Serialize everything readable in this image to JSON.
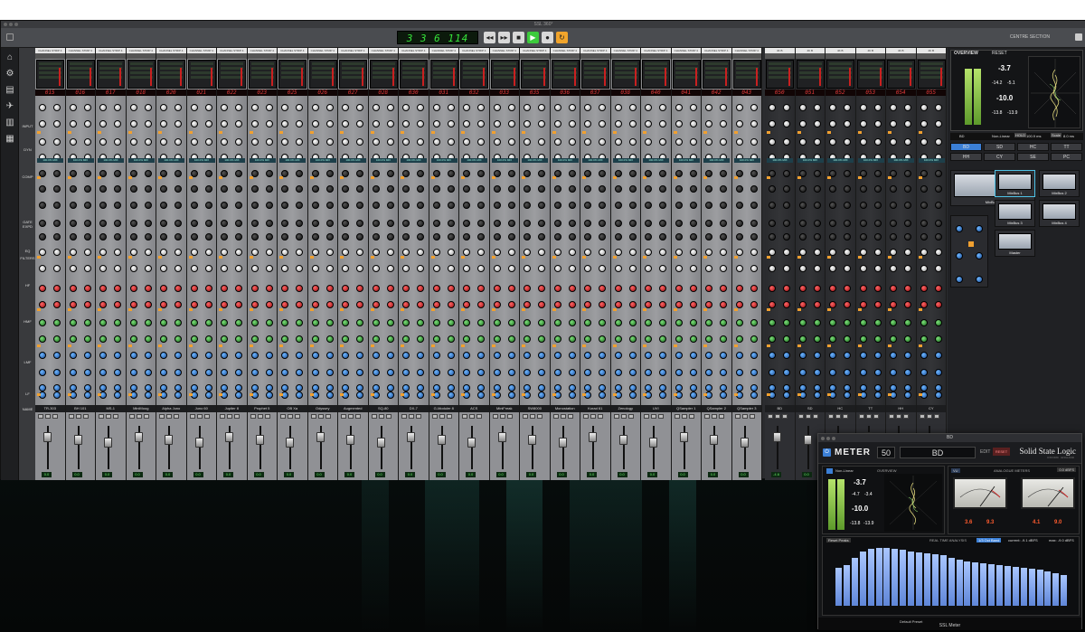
{
  "window": {
    "title": "SSL 360°"
  },
  "transport": {
    "timecode": "3 3 6 114",
    "centre_label": "CENTRE SECTION"
  },
  "nav": {
    "input_label": "INPUT"
  },
  "sections": {
    "dyn": "DYN",
    "comp": "COMP",
    "gate_exp": "GATE EXPD",
    "eq": "EQ",
    "filters": "FILTERS",
    "hf": "HF",
    "hmf": "HMF",
    "lmf": "LMF",
    "lf": "LF",
    "name": "NAME"
  },
  "strip_header": "CHANNEL STRIP 4",
  "bus_header": "4K B",
  "mix_label": "100.0% MIX",
  "fader_value": "0.0",
  "strips": [
    {
      "num": "015",
      "name": "TR-303"
    },
    {
      "num": "016",
      "name": "BH 101"
    },
    {
      "num": "017",
      "name": "MS-1"
    },
    {
      "num": "018",
      "name": "MiniMoog"
    },
    {
      "num": "020",
      "name": "Alpha Juno"
    },
    {
      "num": "021",
      "name": "Juno 60"
    },
    {
      "num": "022",
      "name": "Jupiter 8"
    },
    {
      "num": "023",
      "name": "Prophet 5"
    },
    {
      "num": "025",
      "name": "OB Xa"
    },
    {
      "num": "026",
      "name": "Odyssey"
    },
    {
      "num": "027",
      "name": "Augmented"
    },
    {
      "num": "028",
      "name": "SQ-80"
    },
    {
      "num": "030",
      "name": "DX-7"
    },
    {
      "num": "031",
      "name": "G-Moduler 8"
    },
    {
      "num": "032",
      "name": "ACS"
    },
    {
      "num": "033",
      "name": "MiniFreak"
    },
    {
      "num": "035",
      "name": "SW8000"
    },
    {
      "num": "036",
      "name": "Monostation"
    },
    {
      "num": "037",
      "name": "Korad 61"
    },
    {
      "num": "038",
      "name": "Zenology"
    },
    {
      "num": "040",
      "name": "UVI"
    },
    {
      "num": "041",
      "name": "QSampler 1"
    },
    {
      "num": "042",
      "name": "QSampler 2"
    },
    {
      "num": "043",
      "name": "QSampler 3"
    }
  ],
  "bus_strips": [
    {
      "num": "050",
      "name": "BD"
    },
    {
      "num": "051",
      "name": "SD"
    },
    {
      "num": "052",
      "name": "HC"
    },
    {
      "num": "053",
      "name": "TT"
    },
    {
      "num": "054",
      "name": "HH"
    },
    {
      "num": "055",
      "name": "CY"
    }
  ],
  "bus_readout": "-4.6",
  "centre": {
    "overview_title": "OVERVIEW",
    "overview_reset": "RESET",
    "overview_vals": [
      "-3.7",
      "-14.2",
      "-5.1",
      "-10.0",
      "-13.8",
      "-13.9"
    ],
    "selector": {
      "name": "BD",
      "mode": "Non-Linear",
      "hold_label": "HOLD",
      "hold_value": "100.9 ms",
      "scale_label": "Scale",
      "scale_value": "8.0 ms"
    },
    "group_buttons": [
      "BD",
      "SD",
      "HC",
      "TT",
      "HH",
      "CY",
      "SE",
      "PC"
    ],
    "tiles": [
      "MixBus 1",
      "MixBus 1",
      "MixBus 2",
      "MixBus 3",
      "MixBus 4",
      "Master"
    ]
  },
  "meter_window": {
    "title": "BD",
    "app_label": "METER",
    "channel_number": "50",
    "channel_name": "BD",
    "edit_label": "EDIT",
    "reset_label": "RESET",
    "brand": "Solid State Logic",
    "brand_sub": "OXFORD · ENGLAND",
    "overview_label": "OVERVIEW",
    "mode": "Non-Linear",
    "tpeak": "-3.7",
    "lufs_a": "-4.7",
    "lufs_b": "-3.4",
    "loud": "-10.0",
    "range_a": "-13.8",
    "range_b": "-13.9",
    "analogue_label": "ANALOGUE METERS",
    "vu_mode": "VU",
    "ref_value": "0.0 dBFS",
    "vu_vals": [
      "3.6",
      "9.3",
      "4.1",
      "9.0"
    ],
    "rta_label": "REAL TIME ANALYSIS",
    "reset_peaks": "Reset Peaks",
    "rta_mode": "1/3 Oct Band",
    "current": "current: -9.1 dBFS",
    "max": "max: -9.0 dBFS",
    "preset": "Default Preset",
    "footer": "SSL Meter"
  },
  "rta_values": [
    38,
    41,
    48,
    55,
    57,
    58,
    58,
    57,
    56,
    55,
    54,
    53,
    52,
    51,
    48,
    46,
    45,
    44,
    43,
    42,
    41,
    40,
    39,
    38,
    37,
    36,
    35,
    33,
    31
  ]
}
